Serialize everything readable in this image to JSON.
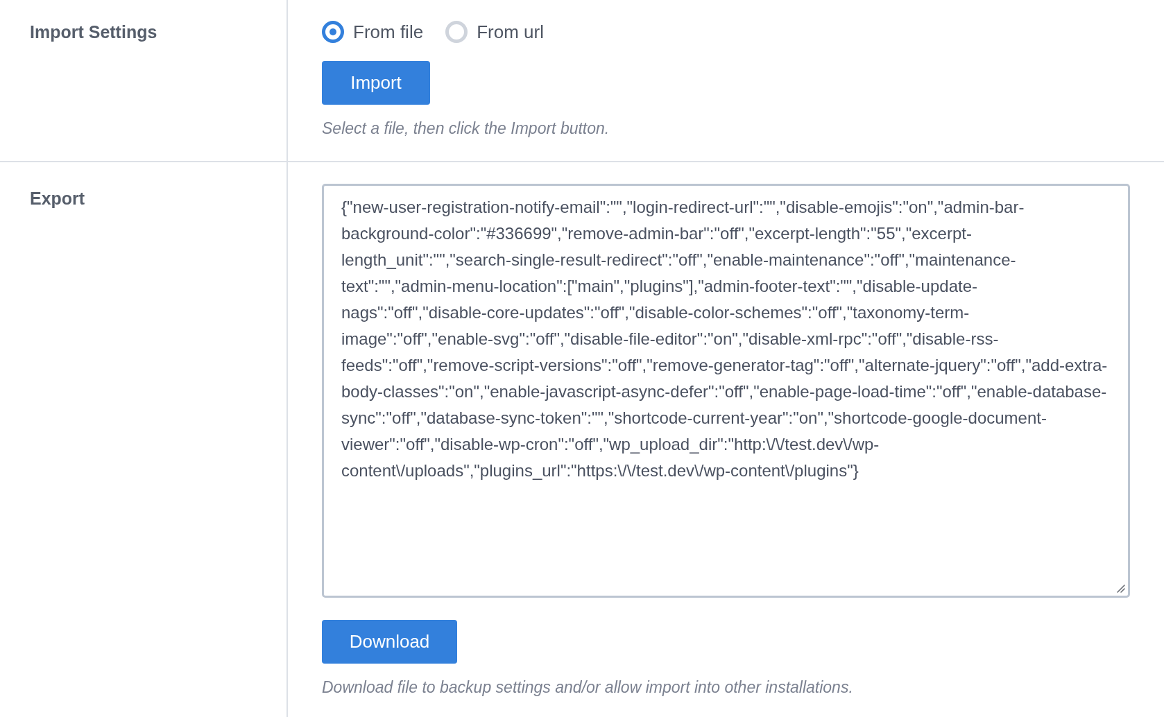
{
  "import_settings": {
    "label": "Import Settings",
    "options": [
      {
        "label": "From file",
        "selected": true
      },
      {
        "label": "From url",
        "selected": false
      }
    ],
    "button": "Import",
    "hint": "Select a file, then click the Import button."
  },
  "export": {
    "label": "Export",
    "value": "{\"new-user-registration-notify-email\":\"\",\"login-redirect-url\":\"\",\"disable-emojis\":\"on\",\"admin-bar-background-color\":\"#336699\",\"remove-admin-bar\":\"off\",\"excerpt-length\":\"55\",\"excerpt-length_unit\":\"\",\"search-single-result-redirect\":\"off\",\"enable-maintenance\":\"off\",\"maintenance-text\":\"\",\"admin-menu-location\":[\"main\",\"plugins\"],\"admin-footer-text\":\"\",\"disable-update-nags\":\"off\",\"disable-core-updates\":\"off\",\"disable-color-schemes\":\"off\",\"taxonomy-term-image\":\"off\",\"enable-svg\":\"off\",\"disable-file-editor\":\"on\",\"disable-xml-rpc\":\"off\",\"disable-rss-feeds\":\"off\",\"remove-script-versions\":\"off\",\"remove-generator-tag\":\"off\",\"alternate-jquery\":\"off\",\"add-extra-body-classes\":\"on\",\"enable-javascript-async-defer\":\"off\",\"enable-page-load-time\":\"off\",\"enable-database-sync\":\"off\",\"database-sync-token\":\"\",\"shortcode-current-year\":\"on\",\"shortcode-google-document-viewer\":\"off\",\"disable-wp-cron\":\"off\",\"wp_upload_dir\":\"http:\\/\\/test.dev\\/wp-content\\/uploads\",\"plugins_url\":\"https:\\/\\/test.dev\\/wp-content\\/plugins\"}",
    "button": "Download",
    "hint": "Download file to backup settings and/or allow import into other installations."
  }
}
